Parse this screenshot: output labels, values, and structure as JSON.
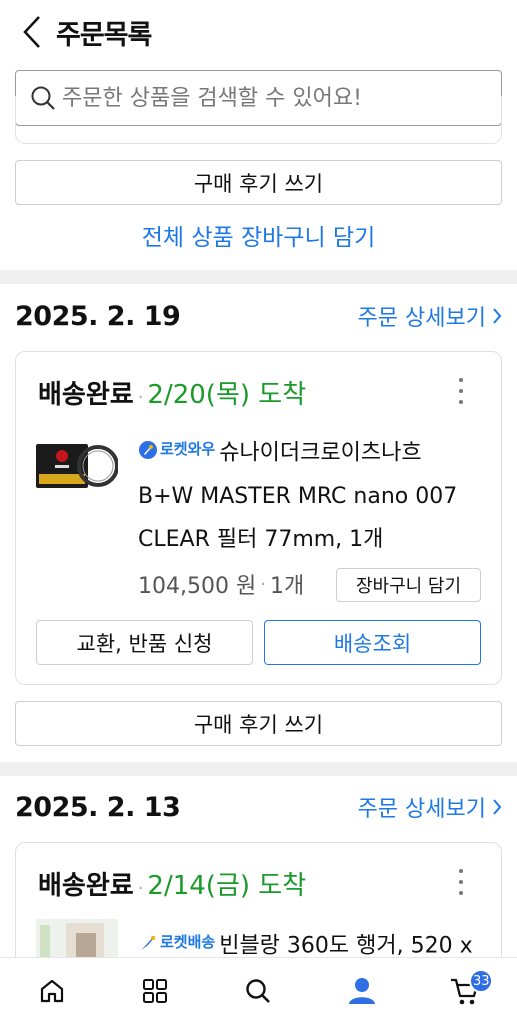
{
  "header": {
    "title": "주문목록"
  },
  "search": {
    "placeholder": "주문한 상품을 검색할 수 있어요!"
  },
  "top_section": {
    "review_button": "구매 후기 쓰기",
    "add_all_to_cart": "전체 상품 장바구니 담기"
  },
  "orders": [
    {
      "date": "2025. 2. 19",
      "detail_link": "주문 상세보기",
      "status": "배송완료",
      "arrival": "2/20(목) 도착",
      "badge": "로켓와우",
      "product_name_line1": "슈나이더크로이츠나흐",
      "product_name_line2": "B+W MASTER MRC nano 007",
      "product_name_line3": "CLEAR 필터 77mm, 1개",
      "price": "104,500 원",
      "quantity": "1개",
      "cart_button": "장바구니 담기",
      "exchange_button": "교환, 반품 신청",
      "tracking_button": "배송조회",
      "review_button": "구매 후기 쓰기"
    },
    {
      "date": "2025. 2. 13",
      "detail_link": "주문 상세보기",
      "status": "배송완료",
      "arrival": "2/14(금) 도착",
      "badge": "로켓배송",
      "product_name_line1": "빈블랑 360도 행거, 520 x"
    }
  ],
  "tabbar": {
    "items": [
      "home-icon",
      "categories-icon",
      "search-icon",
      "my-page-icon",
      "cart-icon"
    ],
    "cart_count": "33"
  },
  "colors": {
    "accent": "#1e78e6",
    "arrival": "#1a9a2a",
    "badge": "#2f6fe6"
  }
}
